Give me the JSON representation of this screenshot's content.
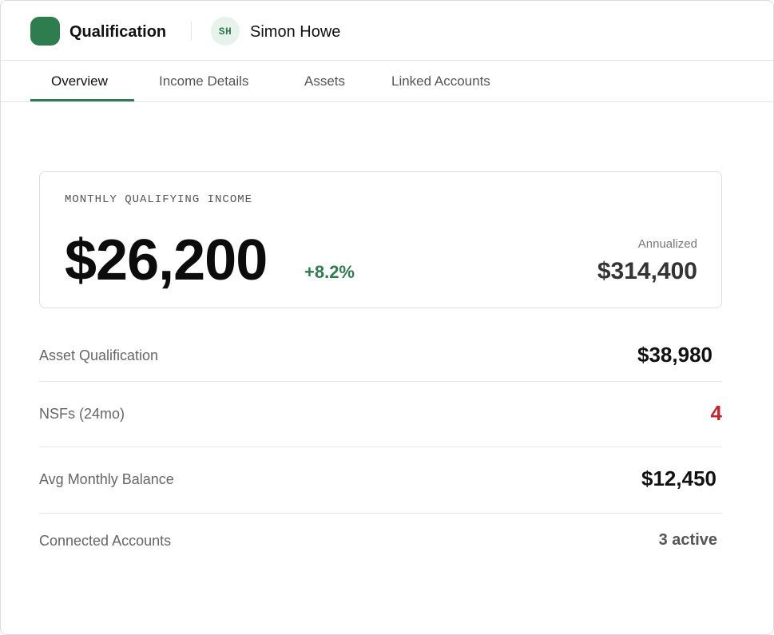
{
  "header": {
    "app_title": "Qualification",
    "avatar_initials": "SH",
    "user_name": "Simon Howe",
    "brand_color": "#2e7d4f"
  },
  "tabs": [
    {
      "label": "Overview",
      "active": true
    },
    {
      "label": "Income Details",
      "active": false
    },
    {
      "label": "Assets",
      "active": false
    },
    {
      "label": "Linked Accounts",
      "active": false
    }
  ],
  "summary": {
    "label": "MONTHLY QUALIFYING INCOME",
    "value": "$26,200",
    "change": "+8.2%",
    "change_color": "#2e7d4f",
    "annualized_label": "Annualized",
    "annualized_value": "$314,400"
  },
  "metrics": [
    {
      "label": "Asset Qualification",
      "value": "$38,980",
      "color": "#111111"
    },
    {
      "label": "NSFs (24mo)",
      "value": "4",
      "color": "#c0282d"
    },
    {
      "label": "Avg Monthly Balance",
      "value": "$12,450",
      "color": "#111111"
    },
    {
      "label": "Connected Accounts",
      "value": "3 active",
      "color": "#555555"
    }
  ]
}
